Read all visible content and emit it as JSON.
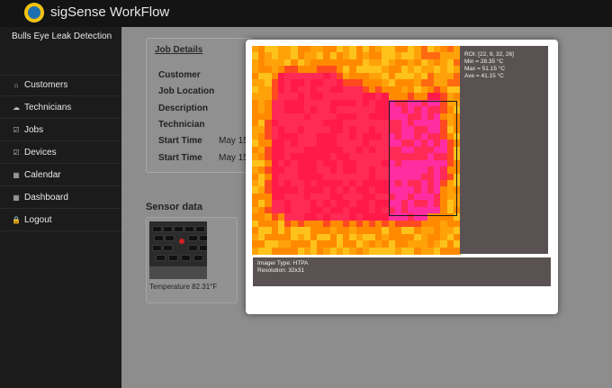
{
  "app": {
    "title": "sigSense WorkFlow"
  },
  "sidebar": {
    "brand": "Bulls Eye Leak Detection",
    "items": [
      {
        "label": "Customers",
        "icon": "home-icon",
        "glyph": "⌂"
      },
      {
        "label": "Technicians",
        "icon": "group-icon",
        "glyph": "☁"
      },
      {
        "label": "Jobs",
        "icon": "edit-check-icon",
        "glyph": "☑"
      },
      {
        "label": "Devices",
        "icon": "edit-check-icon",
        "glyph": "☑"
      },
      {
        "label": "Calendar",
        "icon": "calendar-icon",
        "glyph": "▦"
      },
      {
        "label": "Dashboard",
        "icon": "grid-icon",
        "glyph": "▦"
      },
      {
        "label": "Logout",
        "icon": "lock-icon",
        "glyph": "🔒"
      }
    ]
  },
  "job": {
    "title": "Job Details",
    "fields": [
      {
        "label": "Customer",
        "value": ""
      },
      {
        "label": "Job Location",
        "value": ""
      },
      {
        "label": "Description",
        "value": ""
      },
      {
        "label": "Technician",
        "value": ""
      },
      {
        "label": "Start Time",
        "value": "May 15"
      },
      {
        "label": "Start Time",
        "value": "May 15"
      }
    ]
  },
  "sensor": {
    "title": "Sensor data",
    "temperature_label": "Temperature 82.31°F"
  },
  "thermal": {
    "roi": "ROI: [22, 9, 32, 26]",
    "min": "Min = 28.35 °C",
    "max": "Max = 51.15 °C",
    "ave": "Ave = 41.15 °C",
    "imager_type": "Imager Type: HTPA",
    "resolution": "Resolution: 32x31",
    "grid_cols": 32,
    "grid_rows": 31
  },
  "colors": {
    "hot": "#ff1a4a",
    "hotter": "#ff2da0",
    "warm": "#ff8a00",
    "cool": "#ffc21a"
  }
}
